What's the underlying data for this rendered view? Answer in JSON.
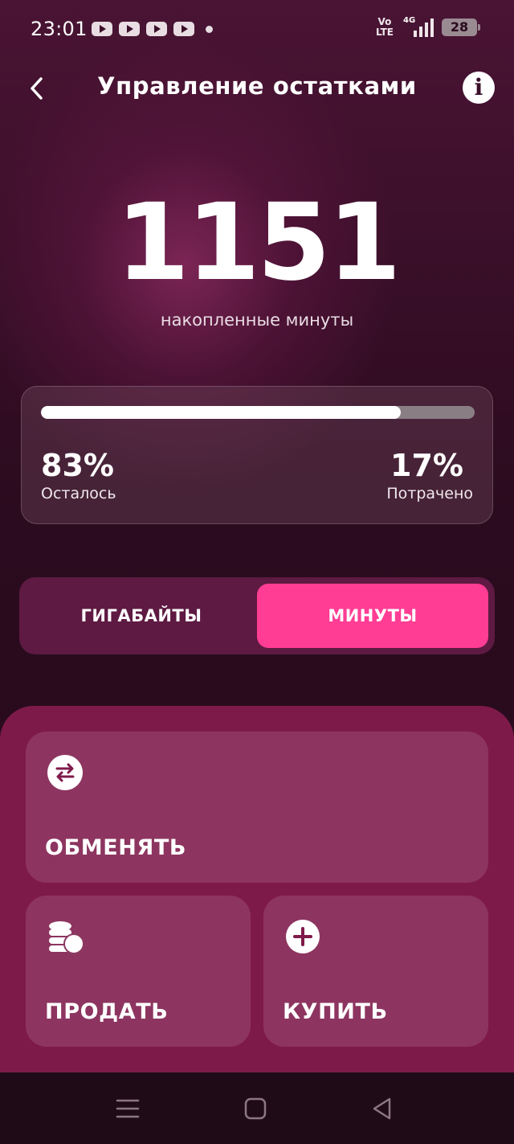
{
  "status_bar": {
    "time": "23:01",
    "volte": "Vo\nLTE",
    "network": "4G",
    "battery": "28",
    "icons": [
      "youtube-icon",
      "youtube-icon",
      "youtube-icon",
      "youtube-icon",
      "notification-dot-icon"
    ]
  },
  "header": {
    "title": "Управление остатками",
    "back_icon": "chevron-left-icon",
    "info_icon": "info-icon"
  },
  "balance": {
    "value": "1151",
    "caption": "накопленные минуты"
  },
  "usage": {
    "remaining_fraction": 0.83,
    "remaining_percent": "83%",
    "remaining_label": "Осталось",
    "spent_percent": "17%",
    "spent_label": "Потрачено"
  },
  "segment": {
    "tabs": [
      "ГИГАБАЙТЫ",
      "МИНУТЫ"
    ],
    "selected": "МИНУТЫ"
  },
  "actions": {
    "exchange": {
      "label": "ОБМЕНЯТЬ",
      "icon": "swap-arrows-icon"
    },
    "sell": {
      "label": "ПРОДАТЬ",
      "icon": "coins-icon"
    },
    "buy": {
      "label": "КУПИТЬ",
      "icon": "plus-circle-icon"
    }
  },
  "colors": {
    "background": "#2a0c1e",
    "accent": "#ff3d94",
    "panel": "#7e1a4a"
  },
  "nav_bar": [
    "menu-icon",
    "home-square-icon",
    "back-triangle-icon"
  ]
}
